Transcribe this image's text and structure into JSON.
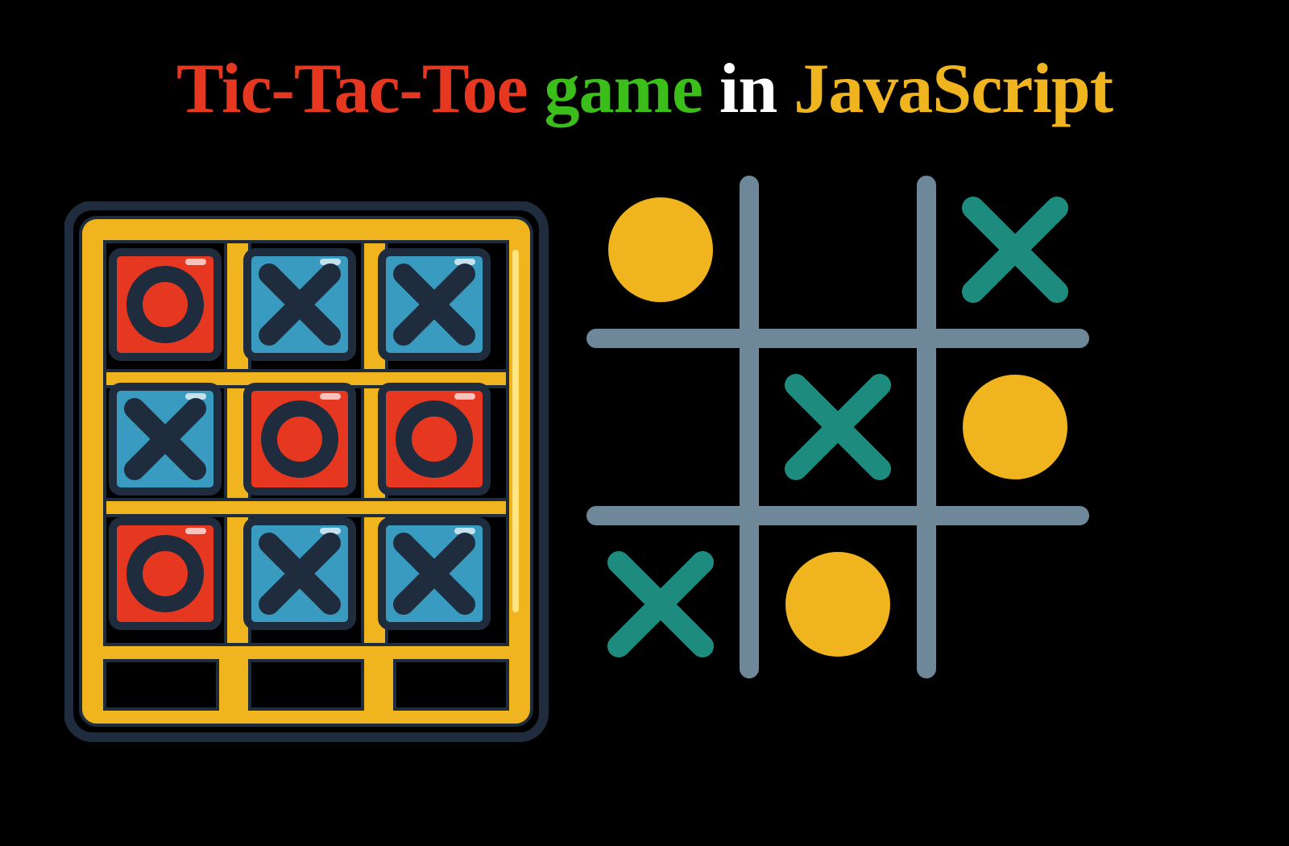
{
  "title": {
    "part1": "Tic-Tac-Toe",
    "part2": "game",
    "part3": "in",
    "part4": "JavaScript"
  },
  "leftBoard": {
    "cells": [
      "O",
      "X",
      "X",
      "X",
      "O",
      "O",
      "O",
      "X",
      "X"
    ],
    "oColor": "#e63820",
    "xColor": "#3a9bc1",
    "frameColor": "#f0b51e",
    "markColor": "#1f2c3d"
  },
  "rightBoard": {
    "cells": [
      "O",
      "",
      "X",
      "",
      "X",
      "O",
      "X",
      "O",
      ""
    ],
    "gridColor": "#6e8899",
    "xColor": "#1d8c7e",
    "oColor": "#f0b51e"
  }
}
